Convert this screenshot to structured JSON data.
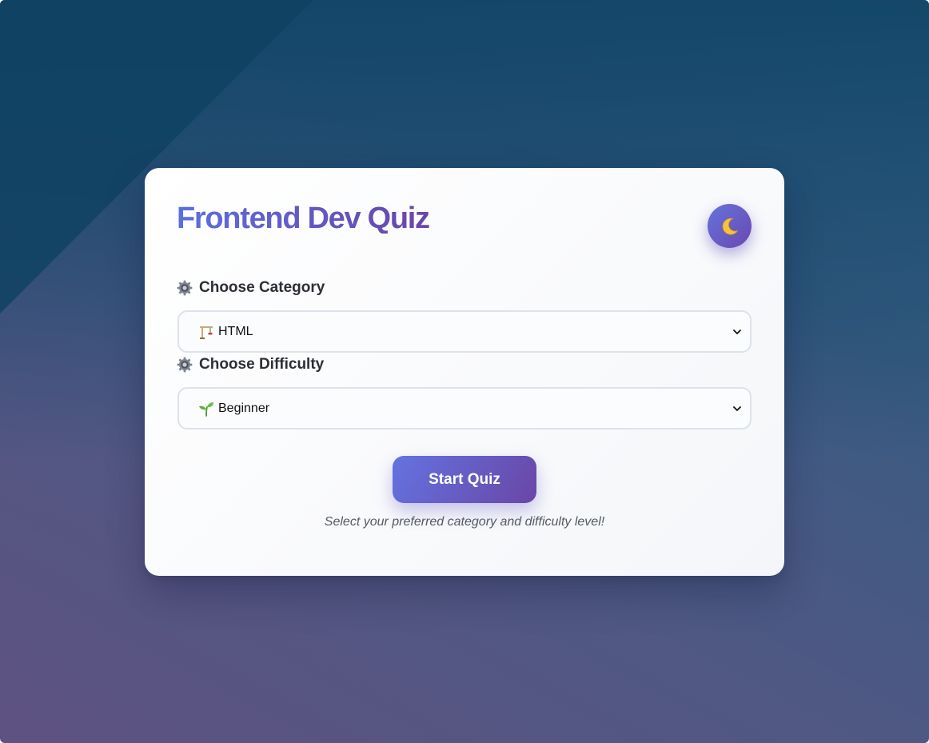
{
  "app": {
    "title": "Frontend Dev Quiz",
    "theme_toggle_icon": "moon-icon"
  },
  "category": {
    "label": "Choose Category",
    "label_icon": "gear-icon",
    "selected_icon": "construction-crane-icon",
    "selected": "HTML"
  },
  "difficulty": {
    "label": "Choose Difficulty",
    "label_icon": "gear-icon",
    "selected_icon": "seedling-icon",
    "selected": "Beginner"
  },
  "actions": {
    "start_label": "Start Quiz"
  },
  "hint": "Select your preferred category and difficulty level!",
  "colors": {
    "accent_start": "#5b6fe0",
    "accent_end": "#6a45a8",
    "background_top": "#114568",
    "background_bottom": "#5e5282"
  }
}
